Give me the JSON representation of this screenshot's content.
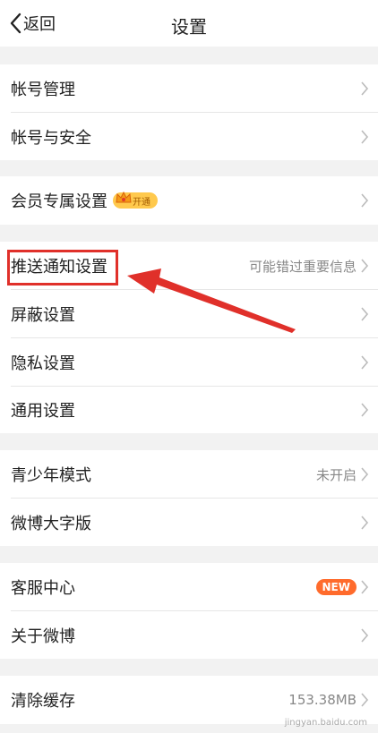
{
  "header": {
    "back_label": "返回",
    "title": "设置"
  },
  "sections": [
    {
      "items": [
        {
          "label": "帐号管理"
        },
        {
          "label": "帐号与安全"
        }
      ]
    },
    {
      "items": [
        {
          "label": "会员专属设置",
          "badge": "开通"
        }
      ]
    },
    {
      "items": [
        {
          "label": "推送通知设置",
          "value": "可能错过重要信息"
        },
        {
          "label": "屏蔽设置"
        },
        {
          "label": "隐私设置"
        },
        {
          "label": "通用设置"
        }
      ]
    },
    {
      "items": [
        {
          "label": "青少年模式",
          "value": "未开启"
        },
        {
          "label": "微博大字版"
        }
      ]
    },
    {
      "items": [
        {
          "label": "客服中心",
          "badge": "NEW"
        },
        {
          "label": "关于微博"
        }
      ]
    },
    {
      "items": [
        {
          "label": "清除缓存",
          "value": "153.38MB"
        }
      ]
    }
  ],
  "watermark": "jingyan.baidu.com",
  "colors": {
    "accent_red": "#e0302a",
    "new_badge": "#ff6b2c",
    "vip_badge": "#ffc94d",
    "background": "#f2f2f2"
  },
  "icons": [
    "back-chevron-icon",
    "chevron-right-icon",
    "crown-icon",
    "annotation-arrow"
  ]
}
